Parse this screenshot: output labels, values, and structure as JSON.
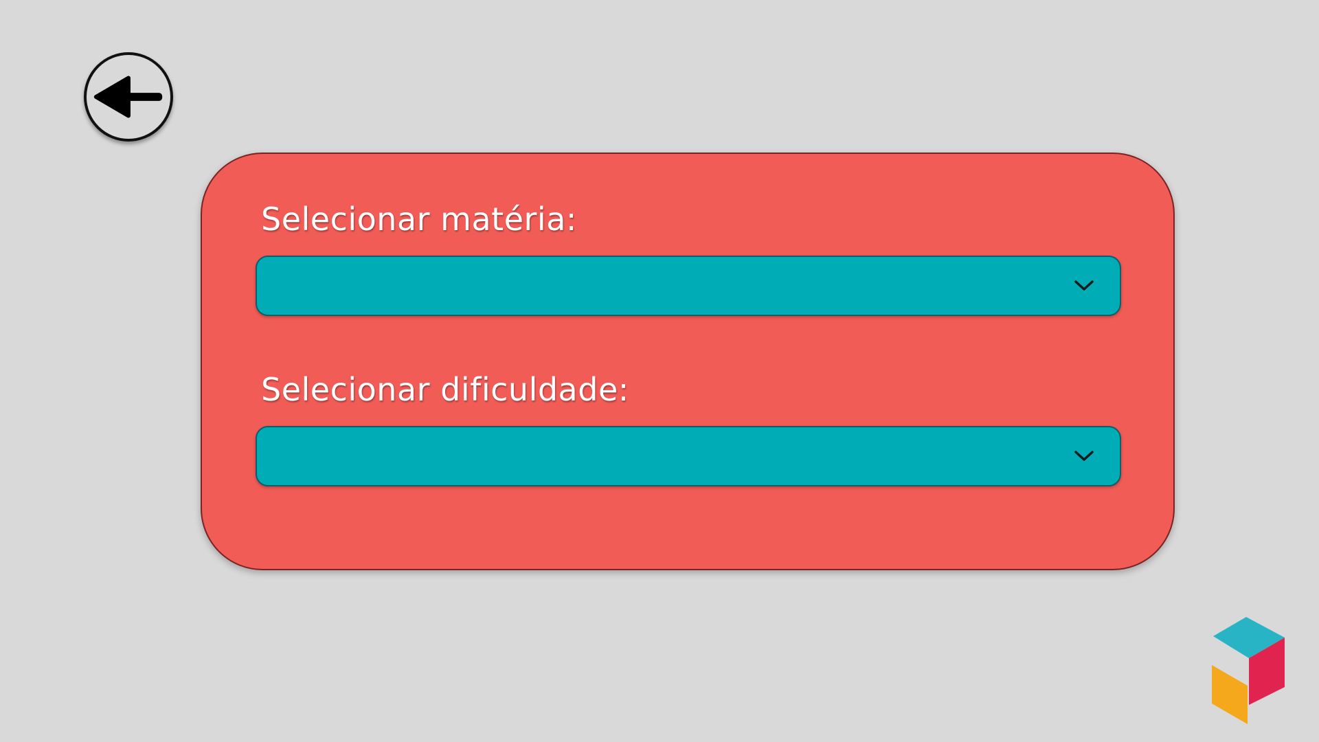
{
  "form": {
    "subject_label": "Selecionar matéria:",
    "subject_value": "",
    "difficulty_label": "Selecionar dificuldade:",
    "difficulty_value": ""
  },
  "icons": {
    "back": "arrow-left-icon",
    "dropdown": "chevron-down-icon",
    "logo": "cube-logo-icon"
  },
  "colors": {
    "background": "#d9d9d9",
    "panel": "#f25c57",
    "select": "#00adb7",
    "logo_top": "#29b4c6",
    "logo_right": "#e0234f",
    "logo_left": "#f5a81c"
  }
}
